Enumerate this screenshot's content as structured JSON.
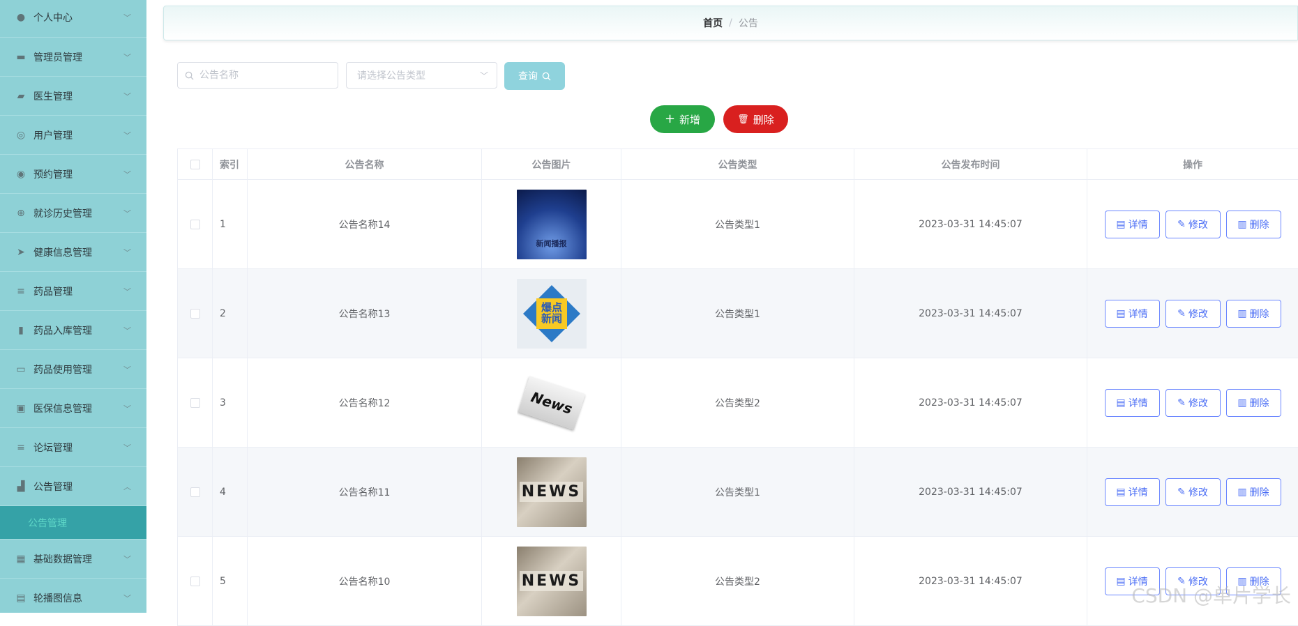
{
  "sidebar": {
    "items": [
      {
        "label": "个人中心",
        "icon": "user-icon"
      },
      {
        "label": "管理员管理",
        "icon": "briefcase-icon"
      },
      {
        "label": "医生管理",
        "icon": "doctor-icon"
      },
      {
        "label": "用户管理",
        "icon": "compass-icon"
      },
      {
        "label": "预约管理",
        "icon": "help-icon"
      },
      {
        "label": "就诊历史管理",
        "icon": "target-icon"
      },
      {
        "label": "健康信息管理",
        "icon": "send-icon"
      },
      {
        "label": "药品管理",
        "icon": "list-icon"
      },
      {
        "label": "药品入库管理",
        "icon": "book-icon"
      },
      {
        "label": "药品使用管理",
        "icon": "chat-icon"
      },
      {
        "label": "医保信息管理",
        "icon": "card-icon"
      },
      {
        "label": "论坛管理",
        "icon": "menu-icon"
      },
      {
        "label": "公告管理",
        "icon": "chart-icon"
      }
    ],
    "active_sub": "公告管理",
    "after": [
      {
        "label": "基础数据管理",
        "icon": "grid-icon"
      },
      {
        "label": "轮播图信息",
        "icon": "image-icon"
      }
    ]
  },
  "breadcrumb": {
    "home": "首页",
    "sep": "/",
    "current": "公告"
  },
  "search": {
    "name_placeholder": "公告名称",
    "type_placeholder": "请选择公告类型",
    "query_label": "查询"
  },
  "actions": {
    "add_label": "新增",
    "delete_label": "删除"
  },
  "table": {
    "headers": {
      "index": "索引",
      "name": "公告名称",
      "image": "公告图片",
      "type": "公告类型",
      "time": "公告发布时间",
      "op": "操作"
    },
    "rows": [
      {
        "index": "1",
        "name": "公告名称14",
        "type": "公告类型1",
        "time": "2023-03-31 14:45:07",
        "thumb_text": "新闻播报"
      },
      {
        "index": "2",
        "name": "公告名称13",
        "type": "公告类型1",
        "time": "2023-03-31 14:45:07",
        "thumb_text": "爆点新闻"
      },
      {
        "index": "3",
        "name": "公告名称12",
        "type": "公告类型2",
        "time": "2023-03-31 14:45:07",
        "thumb_text": "News"
      },
      {
        "index": "4",
        "name": "公告名称11",
        "type": "公告类型1",
        "time": "2023-03-31 14:45:07",
        "thumb_text": "NEWS"
      },
      {
        "index": "5",
        "name": "公告名称10",
        "type": "公告类型2",
        "time": "2023-03-31 14:45:07",
        "thumb_text": "NEWS"
      }
    ],
    "op_labels": {
      "detail": "详情",
      "edit": "修改",
      "delete": "删除"
    }
  },
  "watermark": "CSDN @单片学长"
}
